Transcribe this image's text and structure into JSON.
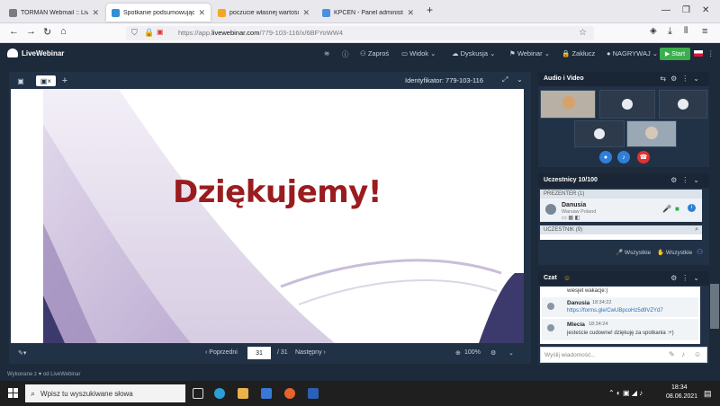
{
  "browser": {
    "tabs": [
      {
        "label": "TORMAN Webmail :: LiveWebin",
        "color": "#7b7b85",
        "active": false
      },
      {
        "label": "Spotkanie podsumowujące w ramach",
        "sub": "6BFVoWW4",
        "color": "#2f8fd8",
        "active": true
      },
      {
        "label": "poczucie własnej wartości - Go",
        "color": "#f5a623",
        "active": false
      },
      {
        "label": "KPCEN - Panel administracyjny",
        "color": "#4a90e2",
        "active": false
      }
    ],
    "url_prefix": "https://app.",
    "url_domain": "livewebinar.com",
    "url_path": "/779-103-116/x/6BFYoWW4"
  },
  "app": {
    "logo": "LiveWebinar",
    "header_items": [
      "Zaproś",
      "Widok",
      "Dyskusja",
      "Webinar",
      "Zakłucz",
      "NAGRYWAJ"
    ],
    "start_label": "Start",
    "identifier_label": "Identyfikator: 779-103-116",
    "slide_title": "Dziękujemy!",
    "prev_label": "‹ Poprzedni",
    "page_current": "31",
    "page_total": "/ 31",
    "next_label": "Następny ›",
    "zoom": "100%",
    "footer_text": "Wykonane z ♥ od LiveWebinar"
  },
  "audio_video": {
    "title": "Audio i Video"
  },
  "participants": {
    "title": "Uczestnicy 10/100",
    "presenter_label": "PREZENTER",
    "presenter_count": "(1)",
    "presenter_name": "Danusia",
    "presenter_location": "Warsaw Poland",
    "attendee_label": "UCZESTNIK",
    "attendee_count": "(9)",
    "wszystkie_1": "Wszystkie",
    "wszystkie_2": "Wszystkie"
  },
  "chat": {
    "title": "Czat",
    "messages": [
      {
        "text": "wiesjet wakacje:)"
      },
      {
        "name": "Danusia",
        "time": "18:34:22",
        "text": "https://forms.gle/CwUBpcoHz5d9VZYd7"
      },
      {
        "name": "Mlecia",
        "time": "18:34:24",
        "text": "jesteście cudowne! dziękuję za spotkania :+)"
      }
    ],
    "placeholder": "Wyślij wiadomość..."
  },
  "taskbar": {
    "search_placeholder": "Wpisz tu wyszukiwane słowa",
    "time": "18:34",
    "date": "08.06.2021"
  },
  "colors": {
    "app_dark": "#1c2a3a",
    "panel": "#223246",
    "slide_title": "#9b1c1f",
    "start_green": "#3cae4d"
  }
}
